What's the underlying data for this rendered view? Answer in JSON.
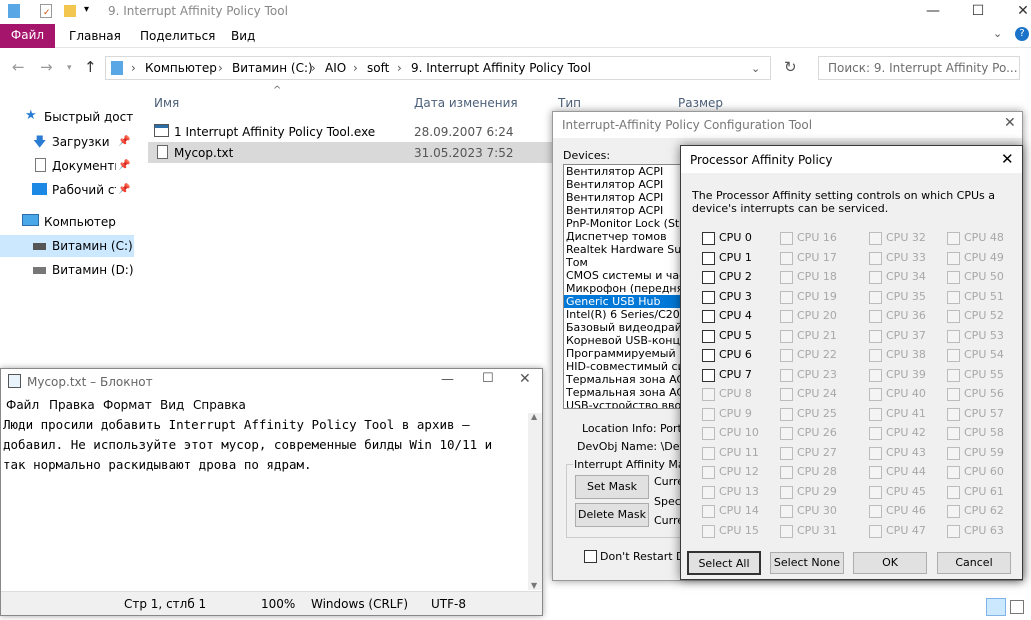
{
  "explorer": {
    "title": "9. Interrupt Affinity Policy Tool",
    "ribbon": {
      "file": "Файл",
      "tabs": [
        "Главная",
        "Поделиться",
        "Вид"
      ]
    },
    "address": [
      "Компьютер",
      "Витамин (C:)",
      "AIO",
      "soft",
      "9. Interrupt Affinity Policy Tool"
    ],
    "search_placeholder": "Поиск: 9. Interrupt Affinity Po...",
    "sidebar": [
      "Быстрый доступ",
      "Загрузки",
      "Документы",
      "Рабочий стол",
      "Компьютер",
      "Витамин (C:)",
      "Витамин (D:)"
    ],
    "columns": [
      "Имя",
      "Дата изменения",
      "Тип",
      "Размер"
    ],
    "files": [
      {
        "name": "1 Interrupt Affinity Policy Tool.exe",
        "date": "28.09.2007 6:24"
      },
      {
        "name": "Мусор.txt",
        "date": "31.05.2023 7:52"
      }
    ]
  },
  "notepad": {
    "title": "Мусор.txt – Блокнот",
    "menu": [
      "Файл",
      "Правка",
      "Формат",
      "Вид",
      "Справка"
    ],
    "text": "Люди просили добавить Interrupt Affinity Policy Tool в архив —\nдобавил. Не используйте этот мусор, современные билды Win 10/11 и\nтак нормально раскидывают дрова по ядрам.",
    "status": [
      "Стр 1, стлб 1",
      "100%",
      "Windows (CRLF)",
      "UTF-8"
    ]
  },
  "config": {
    "title": "Interrupt-Affinity Policy Configuration Tool",
    "devices_label": "Devices:",
    "devices": [
      "Вентилятор ACPI",
      "Вентилятор ACPI",
      "Вентилятор ACPI",
      "Вентилятор ACPI",
      "PnP-Monitor Lock (Stand",
      "Диспетчер томов",
      "Realtek Hardware Suppo",
      "Том",
      "CMOS системы и часы р",
      "Микрофон (передняя п",
      "Generic USB Hub",
      "Intel(R) 6 Series/C200 S",
      "Базовый видеодрайвер",
      "Корневой USB-концент",
      "Программируемый конт",
      "HID-совместимый систе",
      "Термальная зона ACPI",
      "Термальная зона ACPI",
      "USB-устройство ввода"
    ],
    "selected_device": 10,
    "location_label": "Location Info: Port_",
    "devobj_label": "DevObj Name: \\Devic",
    "mask_group": "Interrupt Affinity Mask",
    "set_mask": "Set Mask",
    "delete_mask": "Delete Mask",
    "curr1": "Curre",
    "specif": "Specif",
    "curr2": "Curre",
    "dont_restart": "Don't Restart De"
  },
  "affinity": {
    "title": "Processor Affinity Policy",
    "description": "The Processor Affinity setting controls on which CPUs a device's interrupts can be serviced.",
    "cpu_prefix": "CPU",
    "enabled_count": 8,
    "buttons": {
      "select_all": "Select All",
      "select_none": "Select None",
      "ok": "OK",
      "cancel": "Cancel"
    }
  }
}
